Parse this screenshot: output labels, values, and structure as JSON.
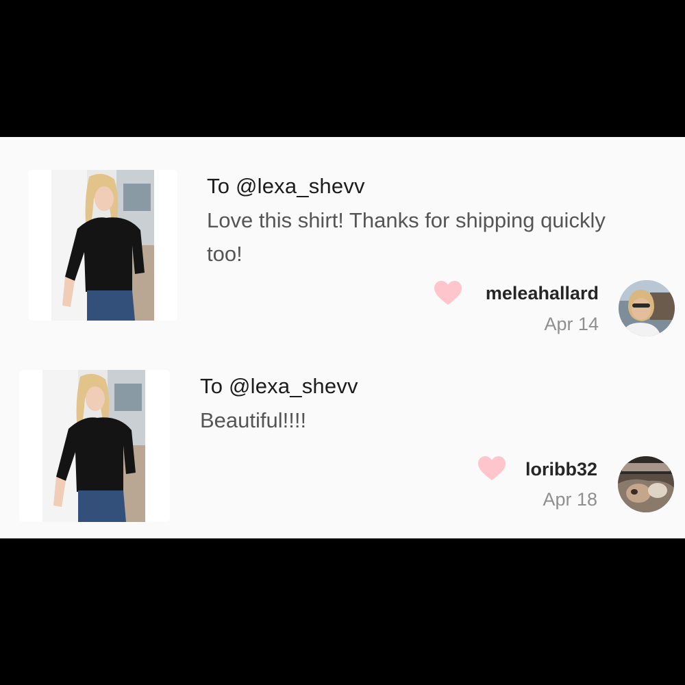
{
  "reviews": [
    {
      "recipient": "To @lexa_shevv",
      "comment": "Love this shirt! Thanks for shipping quickly too!",
      "username": "meleahallard",
      "date": "Apr 14"
    },
    {
      "recipient": "To @lexa_shevv",
      "comment": "Beautiful!!!!",
      "username": "loribb32",
      "date": "Apr 18"
    }
  ],
  "colors": {
    "background": "#000000",
    "panel": "#fafafa",
    "heart": "#ffc5cd",
    "username": "#262626",
    "comment": "#555555",
    "date": "#8f8f8f"
  },
  "icons": {
    "like": "heart-icon",
    "product": "product-photo-black-shirt"
  }
}
